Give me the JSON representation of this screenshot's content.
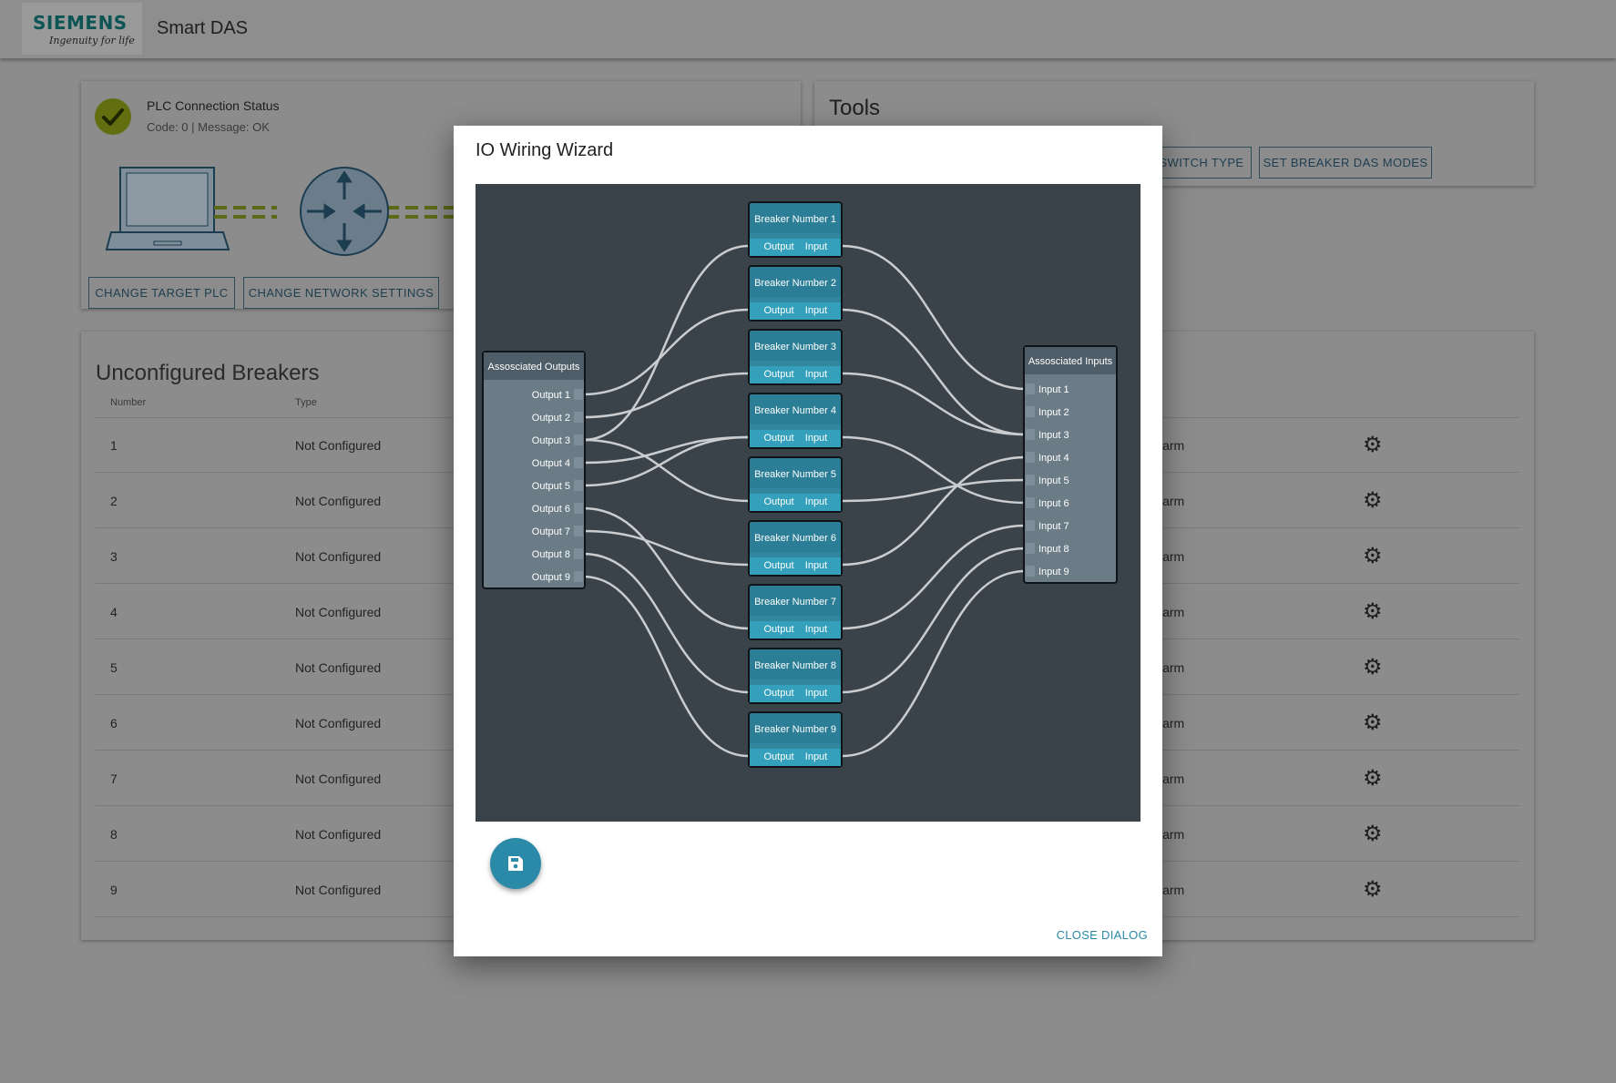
{
  "app": {
    "logo_brand": "SIEMENS",
    "logo_tagline": "Ingenuity for life",
    "title": "Smart DAS"
  },
  "plc": {
    "status_title": "PLC Connection Status",
    "status_message": "Code: 0 | Message: OK",
    "status_icon": "check-circle-icon",
    "buttons": {
      "change_target": "CHANGE TARGET PLC",
      "change_network": "CHANGE NETWORK SETTINGS"
    }
  },
  "tools": {
    "title": "Tools",
    "buttons": {
      "switch_type": "SWITCH TYPE",
      "set_modes": "SET BREAKER DAS MODES"
    }
  },
  "breakers": {
    "title": "Unconfigured Breakers",
    "columns": {
      "number": "Number",
      "type": "Type"
    },
    "rows": [
      {
        "number": "1",
        "type": "Not Configured",
        "alarm": "larm"
      },
      {
        "number": "2",
        "type": "Not Configured",
        "alarm": "larm"
      },
      {
        "number": "3",
        "type": "Not Configured",
        "alarm": "larm"
      },
      {
        "number": "4",
        "type": "Not Configured",
        "alarm": "larm"
      },
      {
        "number": "5",
        "type": "Not Configured",
        "alarm": "larm"
      },
      {
        "number": "6",
        "type": "Not Configured",
        "alarm": "larm"
      },
      {
        "number": "7",
        "type": "Not Configured",
        "alarm": "larm"
      },
      {
        "number": "8",
        "type": "Not Configured",
        "alarm": "larm"
      },
      {
        "number": "9",
        "type": "Not Configured",
        "alarm": "larm"
      }
    ]
  },
  "dialog": {
    "title": "IO Wiring Wizard",
    "close_label": "CLOSE DIALOG",
    "save_icon": "floppy-disk-icon",
    "outputs_header": "Assosciated Outputs",
    "inputs_header": "Assosciated Inputs",
    "outputs": [
      "Output 1",
      "Output 2",
      "Output 3",
      "Output 4",
      "Output 5",
      "Output 6",
      "Output 7",
      "Output 8",
      "Output 9"
    ],
    "inputs": [
      "Input 1",
      "Input 2",
      "Input 3",
      "Input 4",
      "Input 5",
      "Input 6",
      "Input 7",
      "Input 8",
      "Input 9"
    ],
    "breaker_nodes": [
      "Breaker Number 1",
      "Breaker Number 2",
      "Breaker Number 3",
      "Breaker Number 4",
      "Breaker Number 5",
      "Breaker Number 6",
      "Breaker Number 7",
      "Breaker Number 8",
      "Breaker Number 9"
    ],
    "port_output_label": "Output",
    "port_input_label": "Input",
    "output_links": [
      {
        "output": 1,
        "breaker": 2
      },
      {
        "output": 2,
        "breaker": 3
      },
      {
        "output": 3,
        "breaker": 1
      },
      {
        "output": 3,
        "breaker": 5
      },
      {
        "output": 4,
        "breaker": 4
      },
      {
        "output": 5,
        "breaker": 4
      },
      {
        "output": 6,
        "breaker": 7
      },
      {
        "output": 7,
        "breaker": 6
      },
      {
        "output": 8,
        "breaker": 8
      },
      {
        "output": 9,
        "breaker": 9
      }
    ],
    "input_links": [
      {
        "breaker": 1,
        "input": 1
      },
      {
        "breaker": 2,
        "input": 3
      },
      {
        "breaker": 3,
        "input": 3
      },
      {
        "breaker": 4,
        "input": 6
      },
      {
        "breaker": 5,
        "input": 5
      },
      {
        "breaker": 6,
        "input": 4
      },
      {
        "breaker": 7,
        "input": 7
      },
      {
        "breaker": 8,
        "input": 8
      },
      {
        "breaker": 9,
        "input": 9
      }
    ]
  },
  "colors": {
    "overlay": "#8c8c8c",
    "wizard_bg": "#3b434a",
    "node_teal": "#2b7e96",
    "port_teal": "#34a0bb",
    "panel_grey": "#6b7c87",
    "accent": "#2a8aa8",
    "status_ok": "#8db61e"
  }
}
